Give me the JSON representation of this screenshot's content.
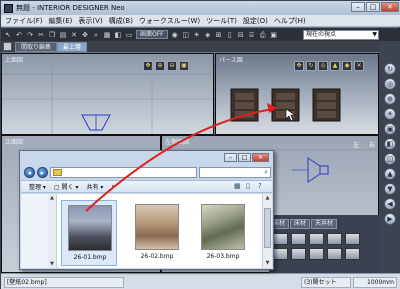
{
  "app": {
    "title": "無題 - INTERIOR DESIGNER Neo"
  },
  "menu": [
    "ファイル(F)",
    "編集(E)",
    "表示(V)",
    "構成(B)",
    "ウォークスルー(W)",
    "ツール(T)",
    "設定(O)",
    "ヘルプ(H)"
  ],
  "toolbar": {
    "toggle_label": "画面OFF",
    "viewpoint_select": "現在の視点"
  },
  "tabs": {
    "floor_edit": "間取り編集",
    "upper_floor": "最上層"
  },
  "viewports": {
    "top": "上面図",
    "perspective": "パース図",
    "front": "正面図",
    "left": "左側面図"
  },
  "side_tabs": [
    "床材",
    "床材",
    "天井材"
  ],
  "right_panel": {
    "header": "図",
    "left_label": "左",
    "right_label": "右"
  },
  "explorer": {
    "organize": "整理",
    "open": "開く",
    "share": "共有",
    "more": "»",
    "files": [
      {
        "name": "26-01.bmp"
      },
      {
        "name": "26-02.bmp"
      },
      {
        "name": "26-03.bmp"
      }
    ]
  },
  "status": {
    "left": "[壁紙02.bmp]",
    "mid": "(3)関セット",
    "right": "1000mm"
  },
  "colors": {
    "arrow": "#e0201a",
    "toolbar_bg": "#2c3038"
  }
}
